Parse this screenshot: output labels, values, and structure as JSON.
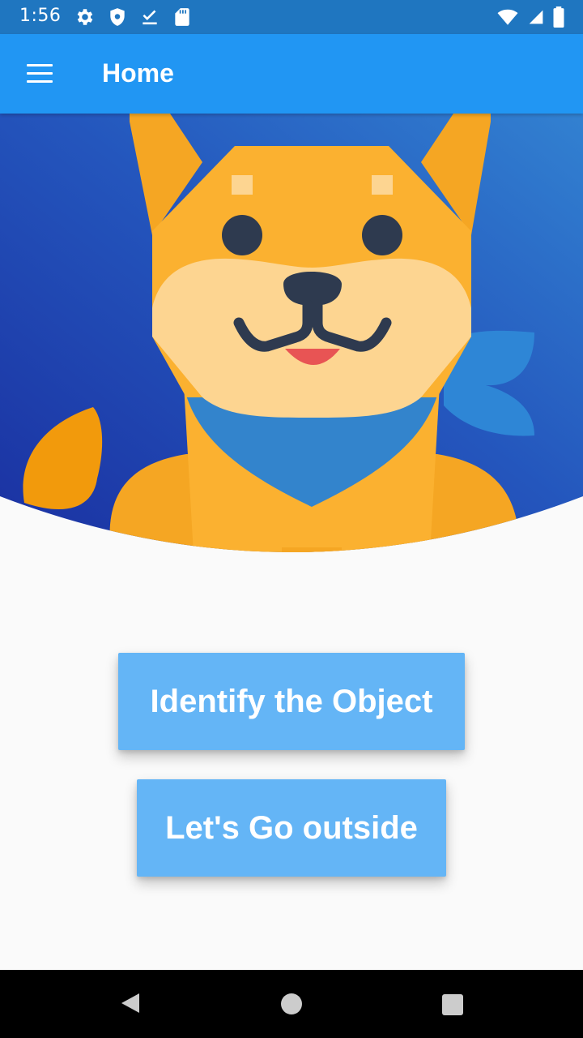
{
  "status_bar": {
    "time": "1:56",
    "left_icons": [
      "settings-icon",
      "shield-icon",
      "download-done-icon",
      "sd-card-icon"
    ],
    "right_icons": [
      "wifi-icon",
      "signal-icon",
      "battery-icon"
    ]
  },
  "app_bar": {
    "menu_icon": "menu-icon",
    "title": "Home"
  },
  "hero": {
    "illustration": "shiba-dog-illustration",
    "background_color": "#1e56b8",
    "dog_color": "#fbb130"
  },
  "actions": {
    "identify_label": "Identify the Object",
    "outside_label": "Let's Go outside"
  },
  "nav_bar": {
    "back_icon": "back-icon",
    "home_icon": "home-icon",
    "recents_icon": "recents-icon"
  },
  "colors": {
    "status_bar": "#1f76c0",
    "app_bar": "#2196f3",
    "button": "#64b5f6",
    "background": "#fafafa"
  }
}
